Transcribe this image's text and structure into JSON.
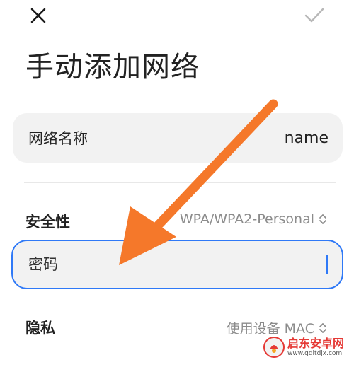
{
  "header": {
    "close_icon": "close-icon",
    "confirm_icon": "check-icon"
  },
  "page_title": "手动添加网络",
  "network_name": {
    "label": "网络名称",
    "value": "name"
  },
  "security": {
    "label": "安全性",
    "value": "WPA/WPA2-Personal",
    "icon": "chevron-updown-icon"
  },
  "password": {
    "placeholder": "密码",
    "value": ""
  },
  "privacy": {
    "label": "隐私",
    "value": "使用设备 MAC",
    "icon": "chevron-updown-icon"
  },
  "watermark": {
    "brand": "启东安卓网",
    "url": "www.qdltdjx.com"
  },
  "colors": {
    "accent": "#2f79f7",
    "annotation_arrow": "#f5782a",
    "field_bg": "#f2f2f2",
    "muted_text": "#8c8c8c"
  }
}
